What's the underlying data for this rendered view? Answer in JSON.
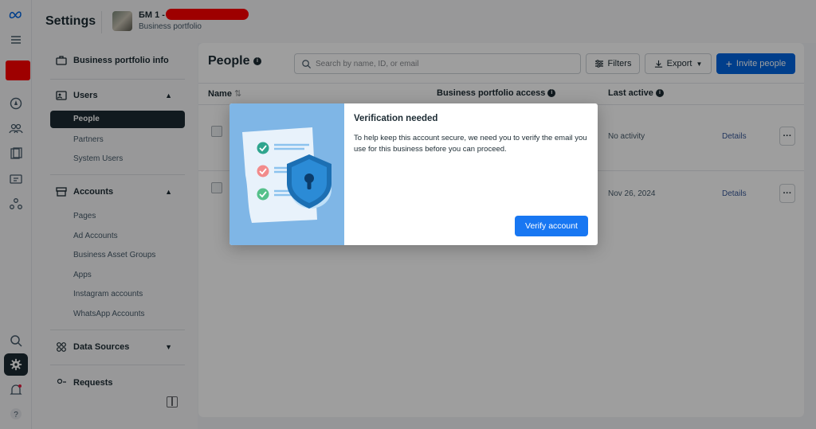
{
  "header": {
    "title": "Settings",
    "portfolio_name": "БМ 1 -",
    "portfolio_type": "Business portfolio"
  },
  "sidebar": {
    "business_info": "Business portfolio info",
    "users_section": "Users",
    "users_items": [
      "People",
      "Partners",
      "System Users"
    ],
    "accounts_section": "Accounts",
    "accounts_items": [
      "Pages",
      "Ad Accounts",
      "Business Asset Groups",
      "Apps",
      "Instagram accounts",
      "WhatsApp Accounts"
    ],
    "data_sources_section": "Data Sources",
    "requests_section": "Requests"
  },
  "main": {
    "title": "People",
    "search_placeholder": "Search by name, ID, or email",
    "filters_label": "Filters",
    "export_label": "Export",
    "invite_label": "Invite people",
    "columns": {
      "name": "Name",
      "access": "Business portfolio access",
      "last_active": "Last active"
    },
    "rows": [
      {
        "last_active": "No activity",
        "details": "Details"
      },
      {
        "last_active": "Nov 26, 2024",
        "details": "Details"
      }
    ]
  },
  "modal": {
    "title": "Verification needed",
    "body": "To help keep this account secure, we need you to verify the email you use for this business before you can proceed.",
    "button": "Verify account"
  },
  "colors": {
    "primary": "#1877f2",
    "dark": "#1c2b33",
    "illustration_bg": "#7fb6e6",
    "redaction": "#ff0000"
  }
}
